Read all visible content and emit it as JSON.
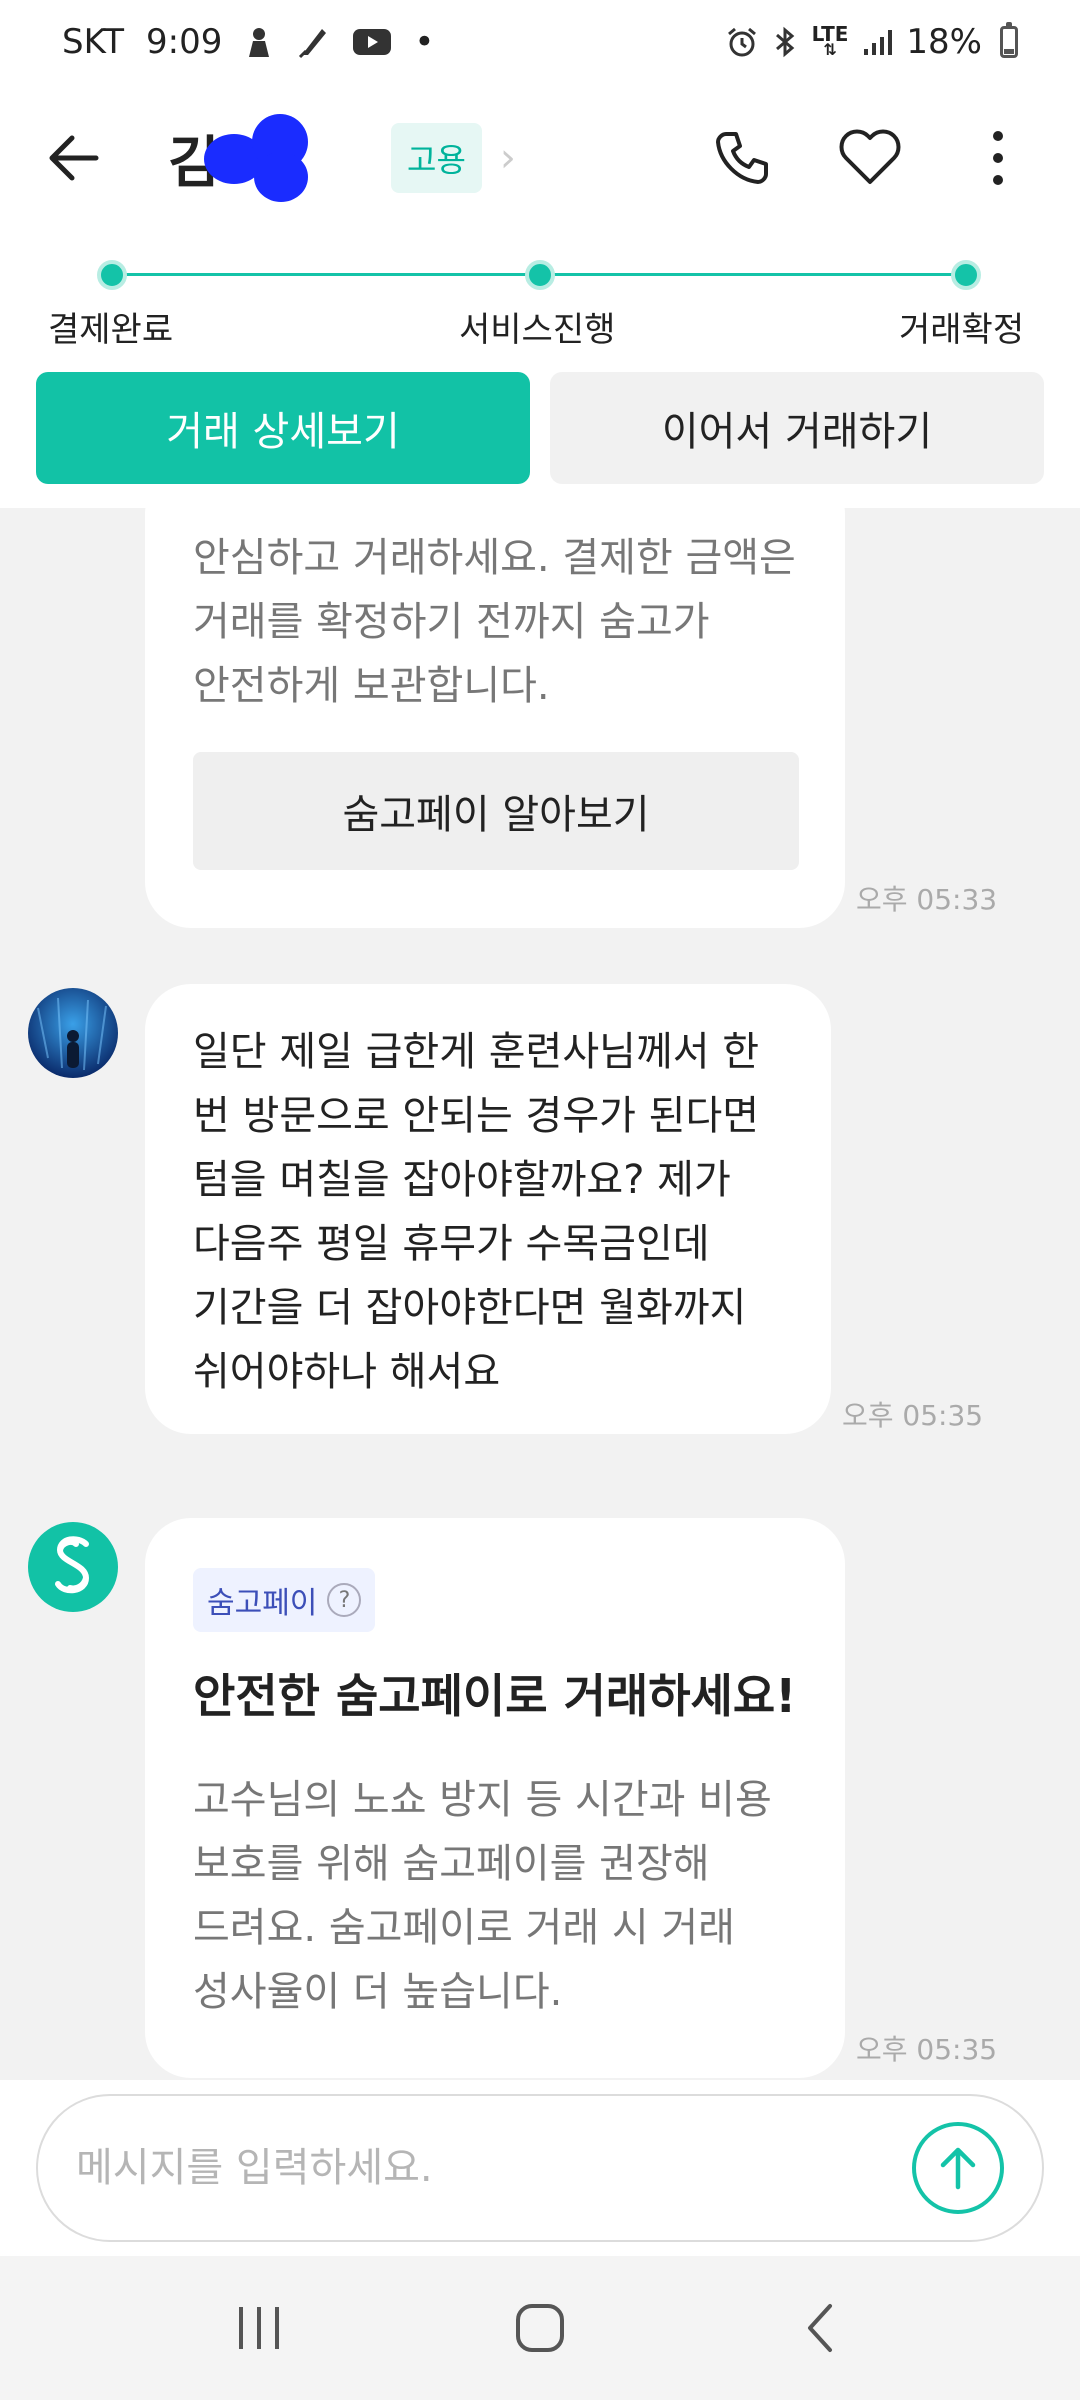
{
  "status_bar": {
    "carrier": "SKT",
    "time": "9:09",
    "dot": "•",
    "battery": "18%",
    "lte": "LTE",
    "left_icons": [
      "usb-debug-icon",
      "quill-icon",
      "youtube-icon"
    ],
    "right_icons": [
      "alarm-icon",
      "bluetooth-icon",
      "lte-icon",
      "signal-icon",
      "battery-icon"
    ]
  },
  "header": {
    "name": "김",
    "badge": "고용",
    "chevron": "›"
  },
  "progress": {
    "steps": [
      "결제완료",
      "서비스진행",
      "거래확정"
    ]
  },
  "actions": {
    "detail": "거래 상세보기",
    "continue": "이어서 거래하기"
  },
  "chat": {
    "msg1": {
      "lines": [
        "안심하고 거래하세요. 결제한 금액은",
        "거래를 확정하기 전까지 숨고가",
        "안전하게 보관합니다."
      ],
      "button": "숨고페이 알아보기",
      "time": "오후 05:33"
    },
    "msg2": {
      "lines": [
        "일단 제일 급한게 훈련사님께서 한",
        "번 방문으로 안되는 경우가 된다면",
        "텀을 며칠을 잡아야할까요? 제가",
        "다음주 평일 휴무가 수목금인데",
        "기간을 더 잡아야한다면 월화까지",
        "쉬어야하나 해서요"
      ],
      "time": "오후 05:35"
    },
    "msg3": {
      "tag": "숨고페이",
      "tag_help": "?",
      "title": "안전한 숨고페이로 거래하세요!",
      "lines": [
        "고수님의 노쇼 방지 등 시간과 비용",
        "보호를 위해 숨고페이를 권장해",
        "드려요. 숨고페이로 거래 시 거래",
        "성사율이 더 높습니다."
      ],
      "time": "오후 05:35"
    }
  },
  "input": {
    "placeholder": "메시지를 입력하세요."
  },
  "colors": {
    "accent": "#12c2a6",
    "chat_bg": "#f2f2f2"
  }
}
